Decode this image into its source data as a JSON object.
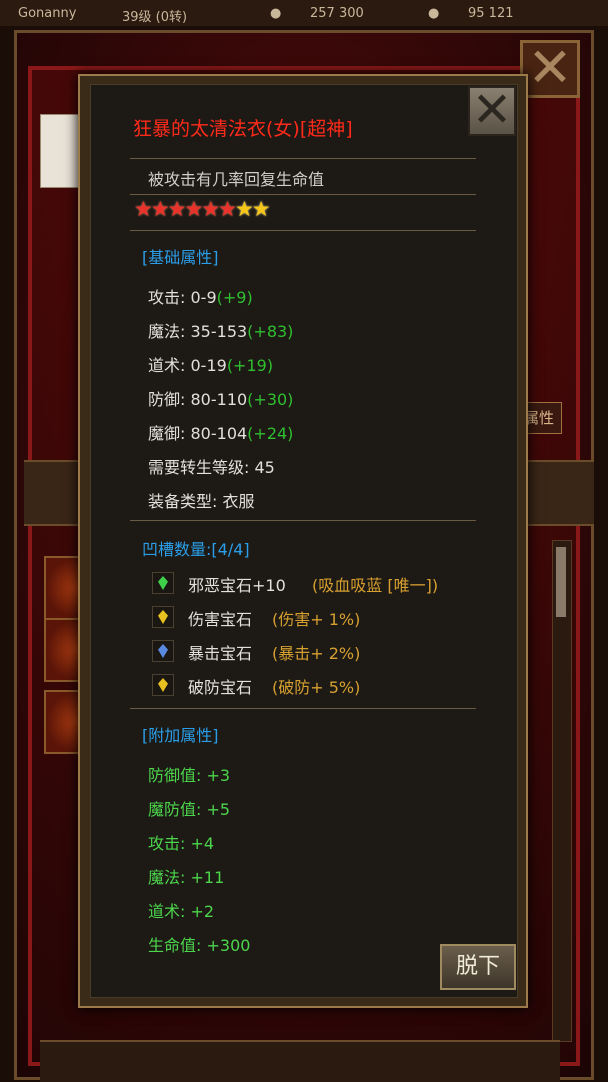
{
  "topbar": {
    "player_name": "Gonanny",
    "level": "39级 (0转)",
    "gold": "257 300",
    "ingot": "95 121"
  },
  "background": {
    "attr_button": "属性"
  },
  "item": {
    "name": "狂暴的太清法衣(女)[超神]",
    "description": "被攻击有几率回复生命值",
    "stars": {
      "red": 6,
      "gold": 2,
      "total": 8
    },
    "star_colors": {
      "red": "#e8322a",
      "gold": "#f5c518"
    }
  },
  "base": {
    "header": "[基础属性]",
    "attack": {
      "label": "攻击:",
      "value": "0-9",
      "bonus": "(+9)"
    },
    "magic": {
      "label": "魔法:",
      "value": "35-153",
      "bonus": "(+83)"
    },
    "tao": {
      "label": "道术:",
      "value": "0-19",
      "bonus": "(+19)"
    },
    "defense": {
      "label": "防御:",
      "value": "80-110",
      "bonus": "(+30)"
    },
    "mdefense": {
      "label": "魔御:",
      "value": "80-104",
      "bonus": "(+24)"
    },
    "rebirth": {
      "label": "需要转生等级:",
      "value": "45"
    },
    "equip_type": {
      "label": "装备类型:",
      "value": "衣服"
    }
  },
  "sockets": {
    "header": "凹槽数量:[4/4]",
    "gems": [
      {
        "icon": "green-gem-icon",
        "color": "#3fd04a",
        "name": "邪恶宝石+10",
        "effect": "(吸血吸蓝 [唯一])"
      },
      {
        "icon": "yellow-gem-icon",
        "color": "#e8c020",
        "name": "伤害宝石",
        "effect": "(伤害+ 1%)"
      },
      {
        "icon": "blue-gem-icon",
        "color": "#5a8ae0",
        "name": "暴击宝石",
        "effect": "(暴击+ 2%)"
      },
      {
        "icon": "yellow-gem-icon",
        "color": "#e8c020",
        "name": "破防宝石",
        "effect": "(破防+ 5%)"
      }
    ]
  },
  "extra": {
    "header": "[附加属性]",
    "lines": [
      "防御值: +3",
      "魔防值: +5",
      "攻击: +4",
      "魔法: +11",
      "道术: +2",
      "生命值: +300"
    ]
  },
  "buttons": {
    "unequip": "脱下",
    "close": "✕"
  }
}
